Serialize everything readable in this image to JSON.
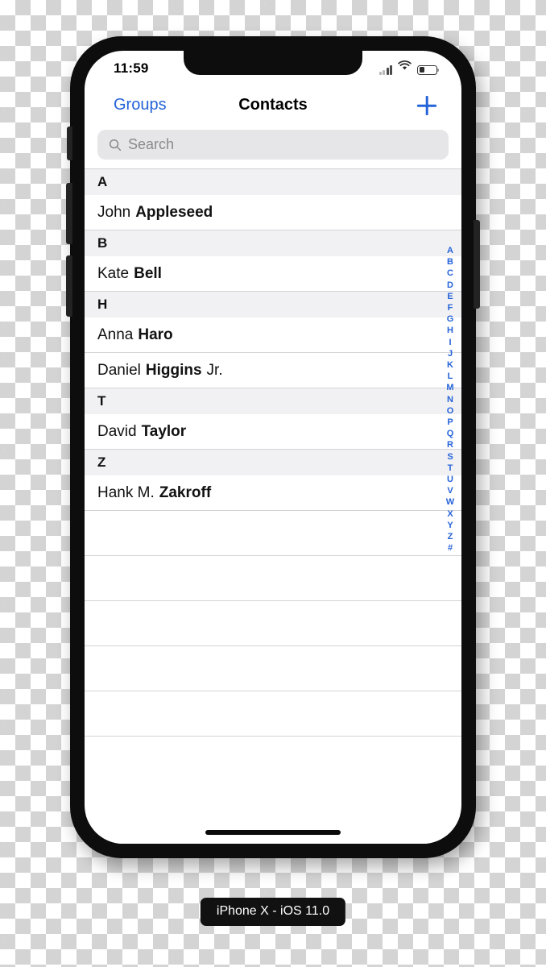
{
  "device": {
    "caption": "iPhone X - iOS 11.0"
  },
  "status_bar": {
    "time": "11:59",
    "signal_icon": "cellular-signal-icon",
    "signal_bars_filled": 2,
    "signal_bars_total": 4,
    "wifi_icon": "wifi-icon",
    "battery_icon": "battery-icon",
    "battery_percent": 30
  },
  "nav_bar": {
    "left_button": "Groups",
    "title": "Contacts",
    "add_button_icon": "plus-icon"
  },
  "search": {
    "placeholder": "Search",
    "value": "",
    "icon": "search-icon"
  },
  "colors": {
    "accent_blue": "#2563d8",
    "section_header_bg": "#f1f1f3",
    "search_bg": "#e6e6e8",
    "separator": "#d4d4d6"
  },
  "contacts": {
    "sections": [
      {
        "letter": "A",
        "rows": [
          {
            "first": "John",
            "last": "Appleseed",
            "suffix": ""
          }
        ]
      },
      {
        "letter": "B",
        "rows": [
          {
            "first": "Kate",
            "last": "Bell",
            "suffix": ""
          }
        ]
      },
      {
        "letter": "H",
        "rows": [
          {
            "first": "Anna",
            "last": "Haro",
            "suffix": ""
          },
          {
            "first": "Daniel",
            "last": "Higgins",
            "suffix": "Jr."
          }
        ]
      },
      {
        "letter": "T",
        "rows": [
          {
            "first": "David",
            "last": "Taylor",
            "suffix": ""
          }
        ]
      },
      {
        "letter": "Z",
        "rows": [
          {
            "first": "Hank M.",
            "last": "Zakroff",
            "suffix": ""
          }
        ]
      }
    ],
    "empty_rows": 5
  },
  "alphabet_index": [
    "A",
    "B",
    "C",
    "D",
    "E",
    "F",
    "G",
    "H",
    "I",
    "J",
    "K",
    "L",
    "M",
    "N",
    "O",
    "P",
    "Q",
    "R",
    "S",
    "T",
    "U",
    "V",
    "W",
    "X",
    "Y",
    "Z",
    "#"
  ]
}
